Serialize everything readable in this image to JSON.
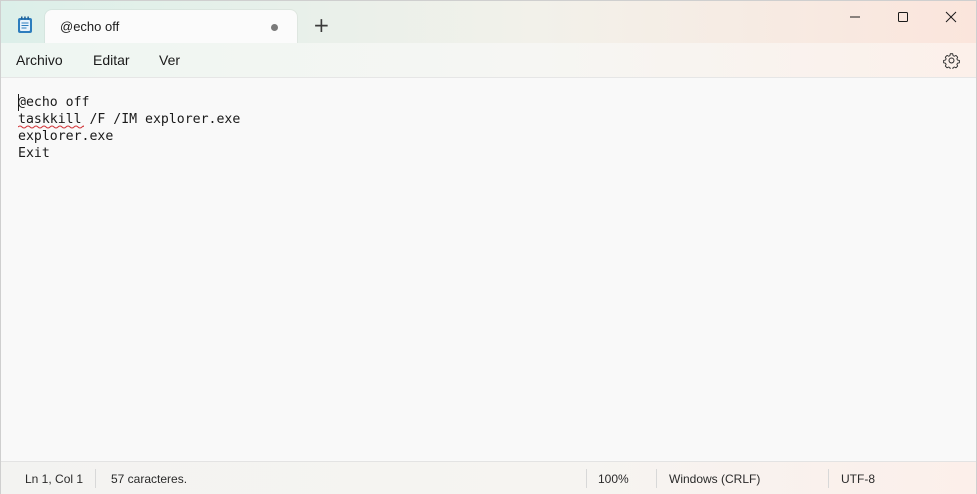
{
  "tab": {
    "title": "@echo off",
    "modified": true,
    "new_tab_symbol": "+"
  },
  "window_controls": [
    "minimize-icon",
    "maximize-icon",
    "close-icon"
  ],
  "menu": {
    "items": [
      "Archivo",
      "Editar",
      "Ver"
    ],
    "settings_icon": "gear-icon"
  },
  "editor": {
    "lines": [
      "@echo off",
      "taskkill /F /IM explorer.exe",
      "explorer.exe",
      "Exit"
    ],
    "misspelled": "taskkill"
  },
  "status": {
    "position": "Ln 1, Col 1",
    "characters": "57 caracteres.",
    "zoom": "100%",
    "line_endings": "Windows (CRLF)",
    "encoding": "UTF-8"
  },
  "colors": {
    "spellcheck_underline": "#d13438",
    "tab_bg": "#fbfbfb"
  }
}
